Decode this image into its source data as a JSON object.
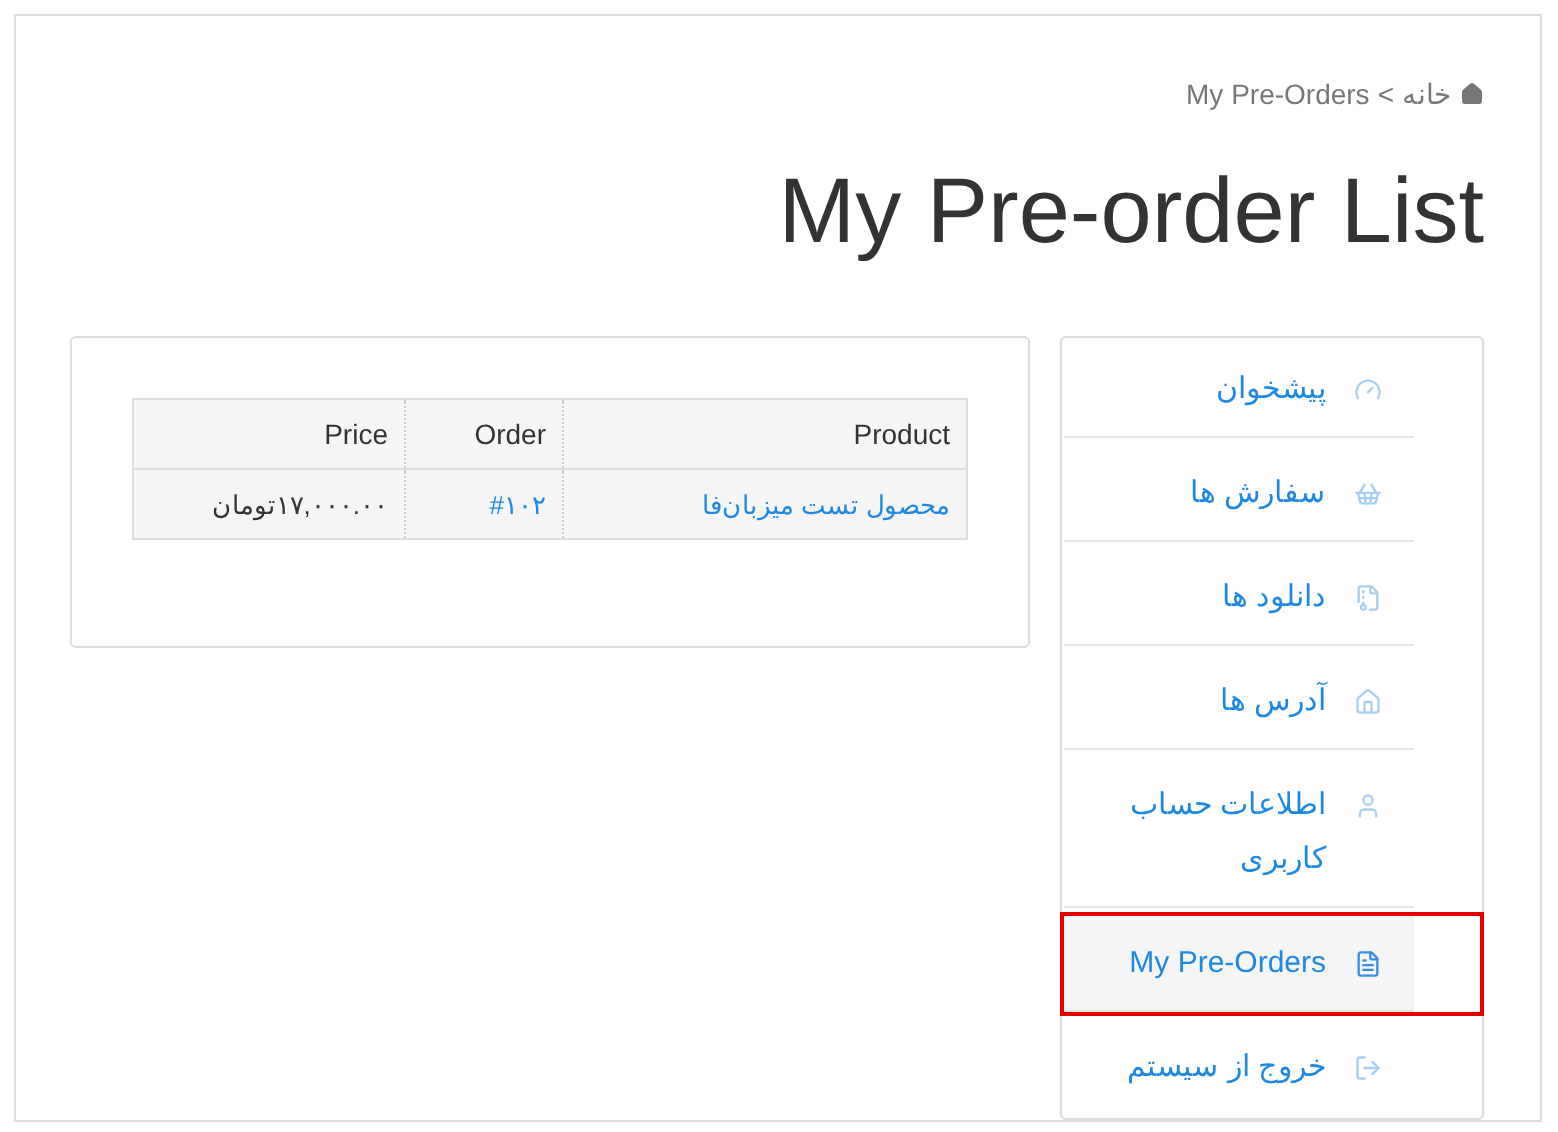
{
  "breadcrumb": {
    "items": [
      {
        "label": "خانه",
        "kind": "home"
      },
      {
        "label": "My Pre-Orders",
        "kind": "current"
      }
    ],
    "separator": ">"
  },
  "title": "My Pre-order List",
  "sidebar": {
    "items": [
      {
        "label": "پیشخوان",
        "kind": "dashboard",
        "selected": false,
        "highlighted": false
      },
      {
        "label": "سفارش ها",
        "kind": "basket",
        "selected": false,
        "highlighted": false
      },
      {
        "label": "دانلود ها",
        "kind": "download",
        "selected": false,
        "highlighted": false
      },
      {
        "label": "آدرس ها",
        "kind": "home",
        "selected": false,
        "highlighted": false
      },
      {
        "label": "اطلاعات حساب کاربری",
        "kind": "user",
        "selected": false,
        "highlighted": false
      },
      {
        "label": "My Pre-Orders",
        "kind": "document",
        "selected": true,
        "highlighted": true
      },
      {
        "label": "خروج از سیستم",
        "kind": "logout",
        "selected": false,
        "highlighted": false
      }
    ]
  },
  "table": {
    "columns": [
      "Product",
      "Order",
      "Price"
    ],
    "rows": [
      {
        "product": "محصول تست میزبان‌فا",
        "order": "#۱۰۲",
        "price": "۱۷,۰۰۰.۰۰تومان"
      }
    ]
  }
}
